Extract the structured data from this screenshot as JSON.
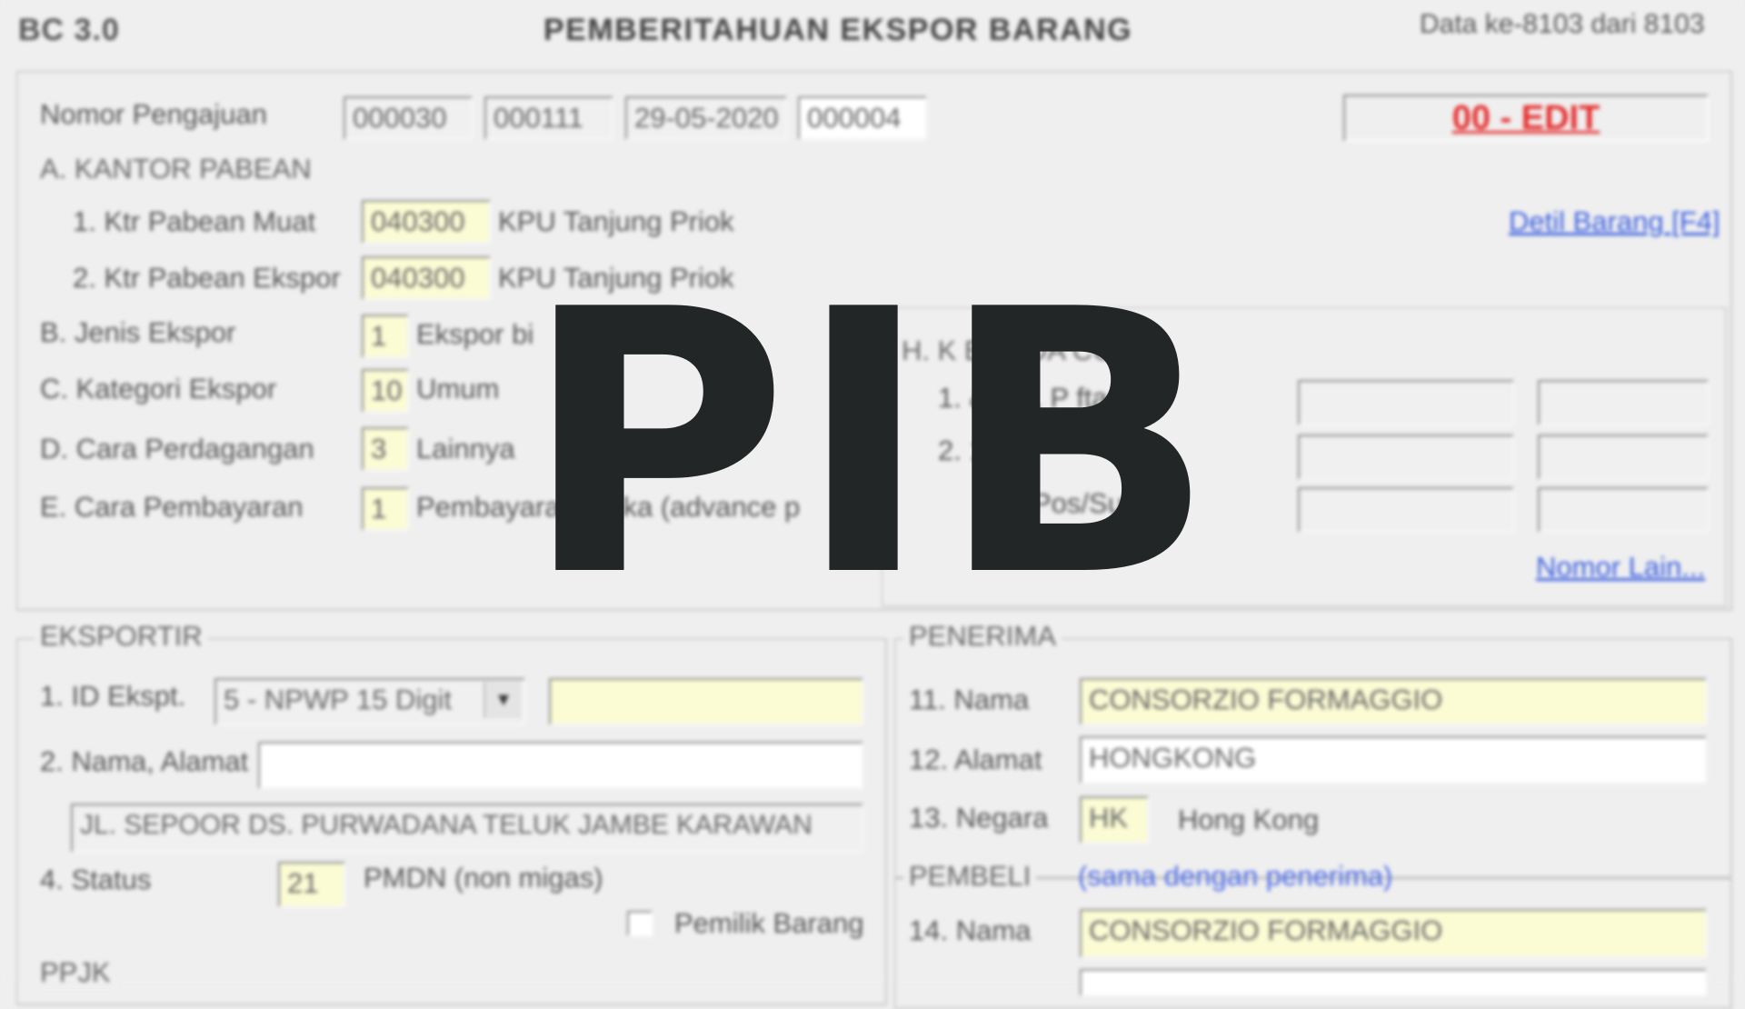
{
  "header": {
    "app_label": "BC 3.0",
    "title": "PEMBERITAHUAN EKSPOR BARANG",
    "record_info": "Data ke-8103 dari 8103"
  },
  "pengajuan": {
    "label": "Nomor Pengajuan",
    "parts": [
      "000030",
      "000111",
      "29-05-2020",
      "000004"
    ],
    "status": "00 - EDIT"
  },
  "kantor": {
    "section": "A. KANTOR PABEAN",
    "muat": {
      "label": "1. Ktr Pabean Muat",
      "code": "040300",
      "desc": "KPU Tanjung Priok"
    },
    "ekspor": {
      "label": "2. Ktr Pabean Ekspor",
      "code": "040300",
      "desc": "KPU Tanjung Priok"
    },
    "detail_link": "Detil Barang [F4]"
  },
  "jenis_ekspor": {
    "label": "B. Jenis Ekspor",
    "code": "1",
    "desc": "Ekspor bi"
  },
  "kategori_ekspor": {
    "label": "C. Kategori Ekspor",
    "code": "10",
    "desc": "Umum"
  },
  "cara_perdagangan": {
    "label": "D. Cara Perdagangan",
    "code": "3",
    "desc": "Lainnya"
  },
  "cara_pembayaran": {
    "label": "E. Cara Pembayaran",
    "code": "1",
    "desc": "Pembayaran muka (advance p"
  },
  "bea_cukai": {
    "title": "H. K          BEA DA CUKAI",
    "row1": "1.        & Tgl. P          ftaran",
    "row2": "2.                   1.",
    "row3": "Pos/Sub",
    "more_link": "Nomor Lain..."
  },
  "eksportir": {
    "title": "EKSPORTIR",
    "id_label": "1. ID Ekspt.",
    "id_type": "5 - NPWP 15 Digit",
    "id_value": "",
    "nama_label": "2. Nama, Alamat",
    "nama_value": "",
    "alamat_value": "JL. SEPOOR DS. PURWADANA TELUK JAMBE KARAWAN",
    "status_label": "4. Status",
    "status_code": "21",
    "status_desc": "PMDN (non migas)",
    "pemilik_label": "Pemilik Barang",
    "ppjk_title": "PPJK"
  },
  "penerima": {
    "title": "PENERIMA",
    "nama_label": "11. Nama",
    "nama_value": "CONSORZIO FORMAGGIO",
    "alamat_label": "12. Alamat",
    "alamat_value": "HONGKONG",
    "negara_label": "13. Negara",
    "negara_code": "HK",
    "negara_desc": "Hong Kong"
  },
  "pembeli": {
    "title": "PEMBELI",
    "same_link": "(sama dengan penerima)",
    "nama_label": "14. Nama",
    "nama_value": "CONSORZIO FORMAGGIO"
  },
  "overlay": {
    "text": "PIB"
  }
}
